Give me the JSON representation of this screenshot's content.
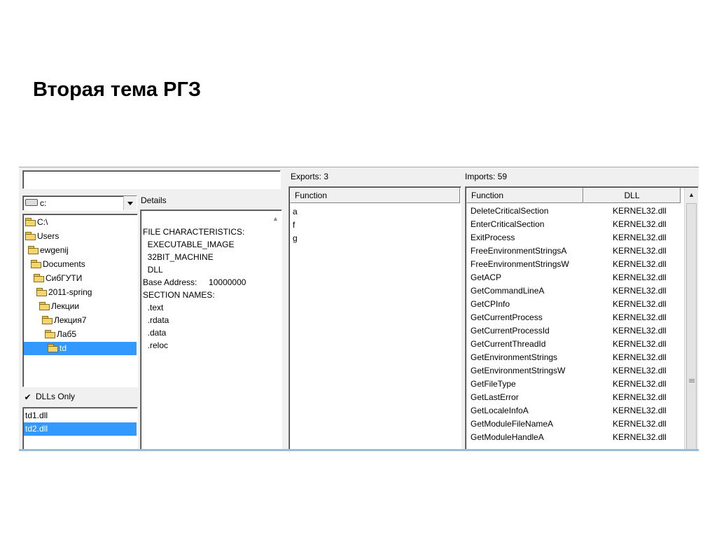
{
  "slide_title": "Вторая тема РГЗ",
  "app": {
    "path_value": "",
    "drive": {
      "selected": "c:"
    },
    "folders": [
      {
        "label": "C:\\"
      },
      {
        "label": "Users"
      },
      {
        "label": "ewgenij"
      },
      {
        "label": "Documents"
      },
      {
        "label": "СибГУТИ"
      },
      {
        "label": "2011-spring"
      },
      {
        "label": "Лекции"
      },
      {
        "label": "Лекция7"
      },
      {
        "label": "Лаб5"
      },
      {
        "label": "td",
        "selected": true
      }
    ],
    "dlls_only_label": "DLLs Only",
    "dlls_only_checked": true,
    "files": [
      {
        "label": "td1.dll"
      },
      {
        "label": "td2.dll",
        "selected": true
      }
    ],
    "details": {
      "header": "Details",
      "lines": [
        "FILE CHARACTERISTICS:",
        "  EXECUTABLE_IMAGE",
        "  32BIT_MACHINE",
        "  DLL",
        "Base Address:     10000000",
        "SECTION NAMES:",
        "  .text",
        "  .rdata",
        "  .data",
        "  .reloc"
      ]
    },
    "exports": {
      "label": "Exports: 3",
      "column": "Function",
      "items": [
        "a",
        "f",
        "g"
      ]
    },
    "imports": {
      "label": "Imports: 59",
      "columns": [
        "Function",
        "DLL"
      ],
      "rows": [
        [
          "DeleteCriticalSection",
          "KERNEL32.dll"
        ],
        [
          "EnterCriticalSection",
          "KERNEL32.dll"
        ],
        [
          "ExitProcess",
          "KERNEL32.dll"
        ],
        [
          "FreeEnvironmentStringsA",
          "KERNEL32.dll"
        ],
        [
          "FreeEnvironmentStringsW",
          "KERNEL32.dll"
        ],
        [
          "GetACP",
          "KERNEL32.dll"
        ],
        [
          "GetCommandLineA",
          "KERNEL32.dll"
        ],
        [
          "GetCPInfo",
          "KERNEL32.dll"
        ],
        [
          "GetCurrentProcess",
          "KERNEL32.dll"
        ],
        [
          "GetCurrentProcessId",
          "KERNEL32.dll"
        ],
        [
          "GetCurrentThreadId",
          "KERNEL32.dll"
        ],
        [
          "GetEnvironmentStrings",
          "KERNEL32.dll"
        ],
        [
          "GetEnvironmentStringsW",
          "KERNEL32.dll"
        ],
        [
          "GetFileType",
          "KERNEL32.dll"
        ],
        [
          "GetLastError",
          "KERNEL32.dll"
        ],
        [
          "GetLocaleInfoA",
          "KERNEL32.dll"
        ],
        [
          "GetModuleFileNameA",
          "KERNEL32.dll"
        ],
        [
          "GetModuleHandleA",
          "KERNEL32.dll"
        ]
      ]
    }
  }
}
